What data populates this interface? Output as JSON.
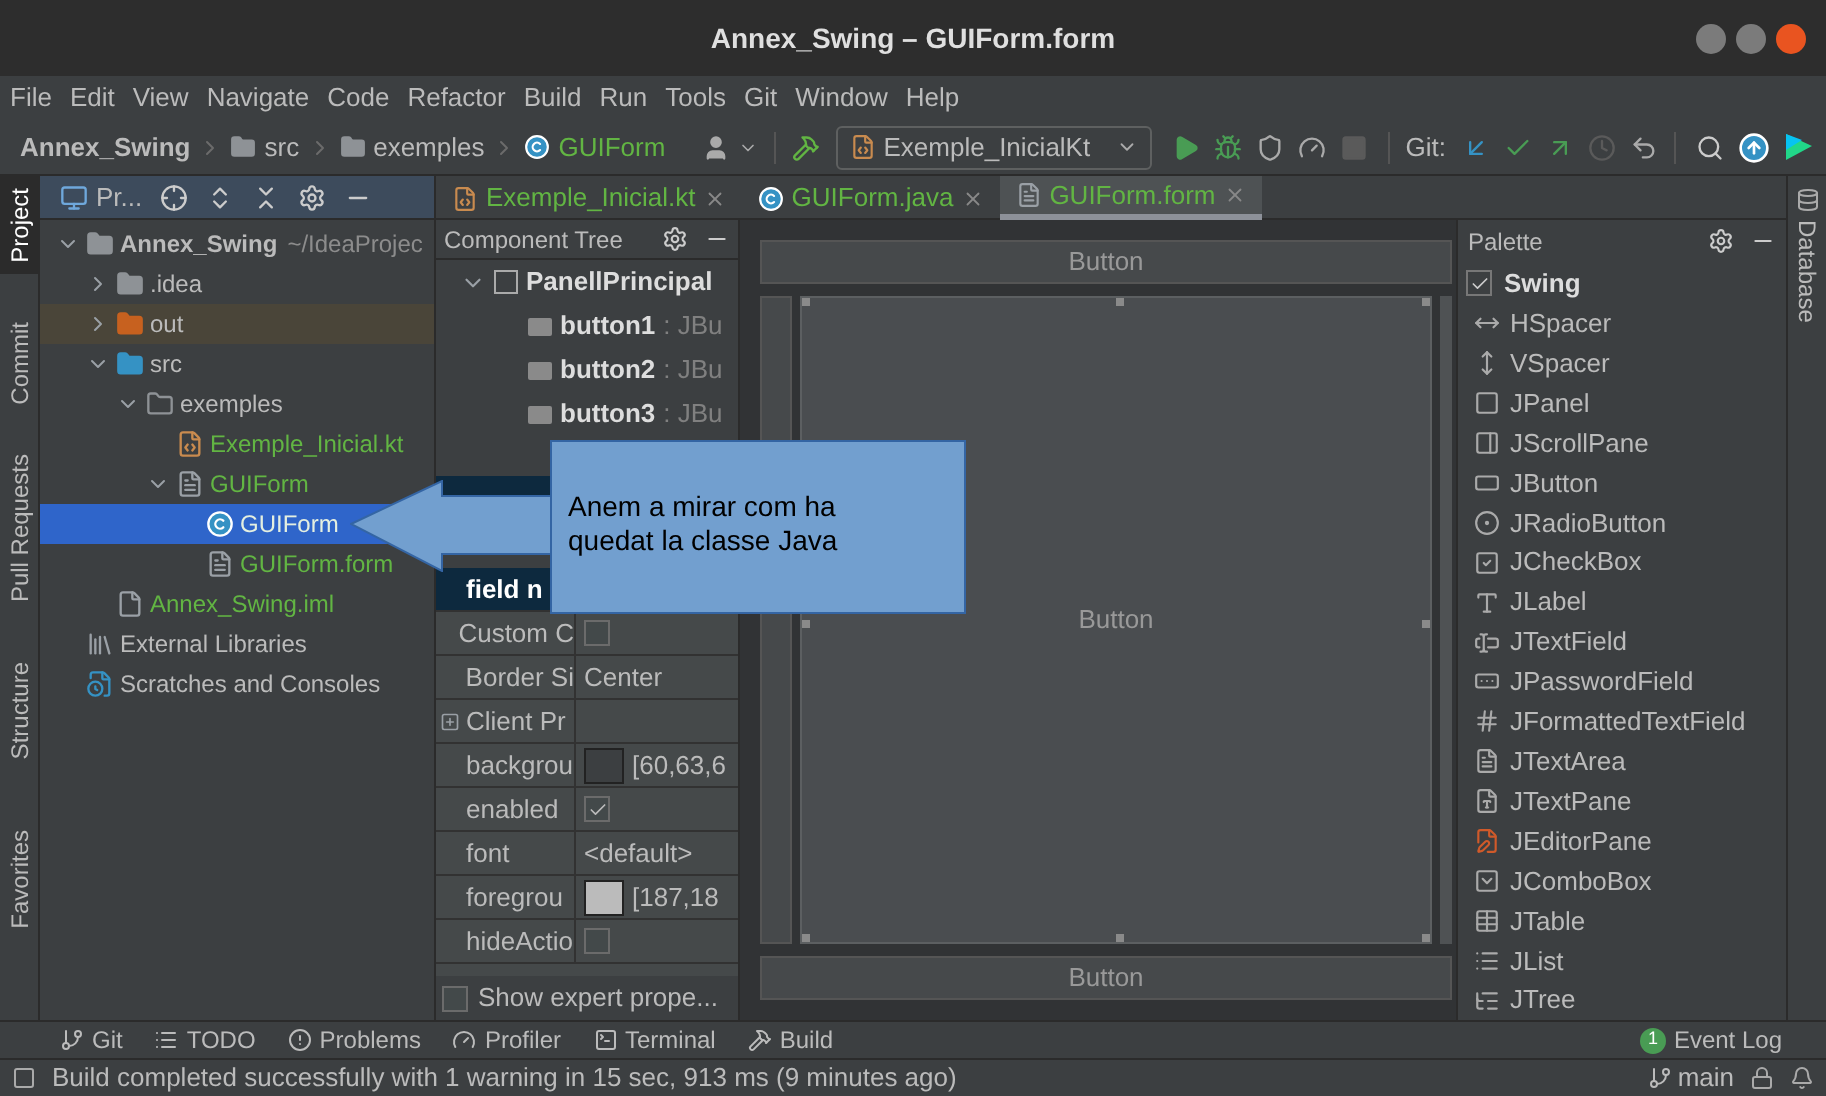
{
  "window": {
    "title": "Annex_Swing – GUIForm.form"
  },
  "menu": [
    "File",
    "Edit",
    "View",
    "Navigate",
    "Code",
    "Refactor",
    "Build",
    "Run",
    "Tools",
    "Git",
    "Window",
    "Help"
  ],
  "breadcrumb": [
    {
      "label": "Annex_Swing",
      "kind": "project"
    },
    {
      "label": "src",
      "kind": "folder"
    },
    {
      "label": "exemples",
      "kind": "folder"
    },
    {
      "label": "GUIForm",
      "kind": "class"
    }
  ],
  "run_config": {
    "label": "Exemple_InicialKt"
  },
  "git_label": "Git:",
  "left_tabs": [
    {
      "label": "Project",
      "selected": true
    },
    {
      "label": "Commit",
      "selected": false
    },
    {
      "label": "Pull Requests",
      "selected": false
    },
    {
      "label": "Structure",
      "selected": false
    },
    {
      "label": "Favorites",
      "selected": false
    }
  ],
  "right_tabs": [
    {
      "label": "Database",
      "selected": false
    }
  ],
  "project_panel": {
    "title": "Pr...",
    "tree": [
      {
        "label": "Annex_Swing",
        "path": "~/IdeaProjec",
        "kind": "module",
        "expanded": true,
        "selected": false,
        "added": false,
        "children": [
          {
            "label": ".idea",
            "kind": "folder",
            "expanded": false,
            "selected": false,
            "added": false
          },
          {
            "label": "out",
            "kind": "excluded",
            "expanded": false,
            "selected": false,
            "added": false
          },
          {
            "label": "src",
            "kind": "source",
            "expanded": true,
            "selected": false,
            "added": false,
            "children": [
              {
                "label": "exemples",
                "kind": "package",
                "expanded": true,
                "selected": false,
                "added": false,
                "children": [
                  {
                    "label": "Exemple_Inicial.kt",
                    "kind": "kotlin",
                    "selected": false,
                    "added": true
                  },
                  {
                    "label": "GUIForm",
                    "kind": "form",
                    "expanded": true,
                    "selected": false,
                    "added": true,
                    "children": [
                      {
                        "label": "GUIForm",
                        "kind": "class",
                        "selected": true,
                        "added": true
                      },
                      {
                        "label": "GUIForm.form",
                        "kind": "form",
                        "selected": false,
                        "added": true
                      }
                    ]
                  }
                ]
              }
            ]
          },
          {
            "label": "Annex_Swing.iml",
            "kind": "iml",
            "selected": false,
            "added": true
          }
        ]
      },
      {
        "label": "External Libraries",
        "kind": "libraries",
        "selected": false,
        "added": false
      },
      {
        "label": "Scratches and Consoles",
        "kind": "scratches",
        "selected": false,
        "added": false
      }
    ]
  },
  "editor_tabs": [
    {
      "label": "Exemple_Inicial.kt",
      "kind": "kotlin",
      "selected": false
    },
    {
      "label": "GUIForm.java",
      "kind": "class",
      "selected": false
    },
    {
      "label": "GUIForm.form",
      "kind": "form",
      "selected": true
    }
  ],
  "component_tree": {
    "title": "Component Tree",
    "root": {
      "name": "PanellPrincipal",
      "expanded": true,
      "checked": false
    },
    "children": [
      {
        "name": "button1",
        "type": ": JBu"
      },
      {
        "name": "button2",
        "type": ": JBu"
      },
      {
        "name": "button3",
        "type": ": JBu"
      }
    ]
  },
  "properties": {
    "rows": [
      {
        "name": "field n",
        "kind": "text",
        "selected": true
      },
      {
        "name": "Custom C",
        "kind": "checkbox",
        "checked": false,
        "selected": false
      },
      {
        "name": "Border Si",
        "kind": "text",
        "value": "Center",
        "selected": false
      },
      {
        "name": "Client Pr",
        "kind": "group",
        "selected": false
      },
      {
        "name": "backgrou",
        "kind": "color",
        "color": "#3c3f41",
        "value": "[60,63,6",
        "selected": false
      },
      {
        "name": "enabled",
        "kind": "checkbox",
        "checked": true,
        "selected": false
      },
      {
        "name": "font",
        "kind": "text",
        "value": "<default>",
        "selected": false
      },
      {
        "name": "foregrou",
        "kind": "color",
        "color": "#bbbbbb",
        "value": "[187,18",
        "selected": false
      },
      {
        "name": "hideActio",
        "kind": "checkbox",
        "checked": false,
        "selected": false
      }
    ],
    "expert": {
      "label": "Show expert prope...",
      "checked": false
    }
  },
  "form": {
    "north": "Button",
    "center": "Button",
    "south": "Button"
  },
  "palette": {
    "title": "Palette",
    "group": {
      "label": "Swing",
      "checked": true
    },
    "items": [
      "HSpacer",
      "VSpacer",
      "JPanel",
      "JScrollPane",
      "JButton",
      "JRadioButton",
      "JCheckBox",
      "JLabel",
      "JTextField",
      "JPasswordField",
      "JFormattedTextField",
      "JTextArea",
      "JTextPane",
      "JEditorPane",
      "JComboBox",
      "JTable",
      "JList",
      "JTree"
    ]
  },
  "callout": {
    "text": "Anem a mirar com ha quedat la classe Java"
  },
  "tool_windows": [
    {
      "label": "Git"
    },
    {
      "label": "TODO"
    },
    {
      "label": "Problems"
    },
    {
      "label": "Profiler"
    },
    {
      "label": "Terminal"
    },
    {
      "label": "Build"
    }
  ],
  "event_log": {
    "label": "Event Log",
    "count": "1"
  },
  "status_bar": {
    "message": "Build completed successfully with 1 warning in 15 sec, 913 ms (9 minutes ago)",
    "branch": "main"
  }
}
